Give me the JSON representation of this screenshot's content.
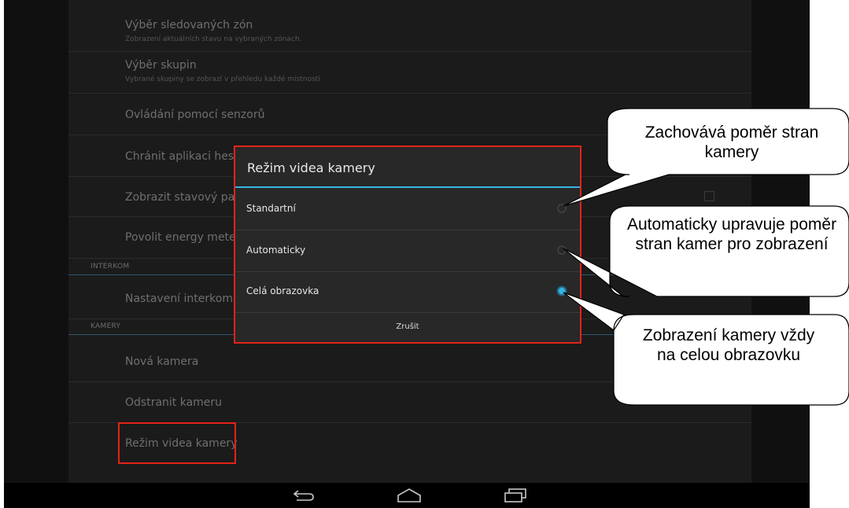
{
  "settings": {
    "rows": [
      {
        "title": "Výběr sledovaných zón",
        "subtitle": "Zobrazení aktuálních stavu na vybraných zónach."
      },
      {
        "title": "Výběr skupin",
        "subtitle": "Vybrané skupiny se zobrazí v přehledu každé místnosti"
      },
      {
        "title": "Ovládání pomocí senzorů"
      },
      {
        "title": "Chránit aplikaci heslem"
      },
      {
        "title": "Zobrazit stavový panel"
      },
      {
        "title": "Povolit energy metering"
      }
    ],
    "section_interkom": "INTERKOM",
    "interkom_item": "Nastavení interkomu",
    "section_kamery": "KAMERY",
    "kamery_items": [
      "Nová kamera",
      "Odstranit kameru",
      "Režim videa kamery"
    ]
  },
  "dialog": {
    "title": "Režim videa kamery",
    "options": [
      {
        "label": "Standartní",
        "selected": false
      },
      {
        "label": "Automaticky",
        "selected": false
      },
      {
        "label": "Celá obrazovka",
        "selected": true
      }
    ],
    "cancel_label": "Zrušit"
  },
  "callouts": [
    {
      "text": "Zachovává poměr stran kamery"
    },
    {
      "text": "Automaticky upravuje poměr stran kamer pro zobrazení"
    },
    {
      "text": "Zobrazení kamery vždy na celou obrazovku"
    }
  ],
  "navbar": {
    "icons": [
      "back-icon",
      "home-icon",
      "recent-apps-icon"
    ]
  },
  "colors": {
    "accent": "#33b5e5",
    "highlight": "#e2231a",
    "background": "#1b1b1b"
  }
}
